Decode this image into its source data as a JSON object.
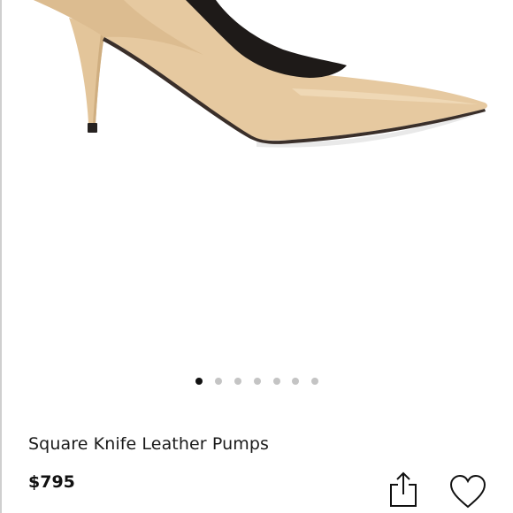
{
  "product": {
    "title": "Square Knife Leather Pumps",
    "price": "$795",
    "image_icon": "shoe-image",
    "colors": {
      "leather": "#e6c9a0",
      "sole": "#3a2f2a",
      "lining": "#1e1a18"
    }
  },
  "gallery": {
    "total_images": 7,
    "active_index": 0
  },
  "actions": {
    "share_icon": "share-icon",
    "wishlist_icon": "heart-icon"
  }
}
